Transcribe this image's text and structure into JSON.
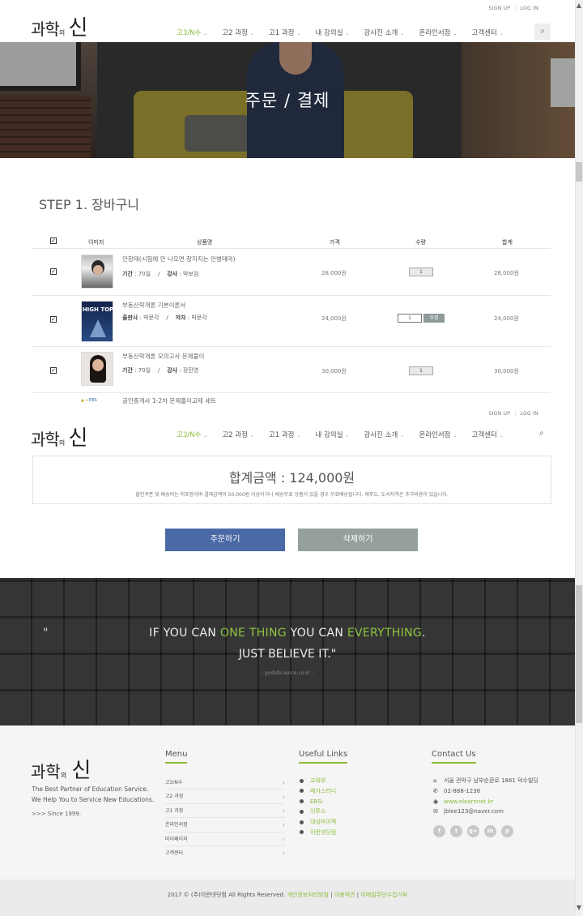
{
  "header": {
    "logo_main": "과학",
    "logo_small": "의",
    "logo_big": "신",
    "toplinks": [
      "SIGN UP",
      "LOG IN"
    ],
    "nav": [
      {
        "label": "고3/N수",
        "active": true
      },
      {
        "label": "고2 과정",
        "active": false
      },
      {
        "label": "고1 과정",
        "active": false
      },
      {
        "label": "내 강의실",
        "active": false
      },
      {
        "label": "강사진 소개",
        "active": false
      },
      {
        "label": "온라인서점",
        "active": false
      },
      {
        "label": "고객센터",
        "active": false
      }
    ]
  },
  "hero": {
    "title": "주문 / 결제"
  },
  "cart": {
    "step_title": "STEP 1. 장바구니",
    "columns": [
      "이미지",
      "상품명",
      "가격",
      "수량",
      "합계"
    ],
    "rows": [
      {
        "name": "안창태(시험에 안 나오면 장지지는 만병테마)",
        "info_a_label": "기간",
        "info_a": "70일",
        "info_b_label": "강사",
        "info_b": "박보검",
        "price": "28,000원",
        "qty": "1",
        "total": "28,000원",
        "editable": false
      },
      {
        "name": "부동산학개론 기본이론서",
        "info_a_label": "출판사",
        "info_a": "박문각",
        "info_b_label": "저자",
        "info_b": "박문각",
        "price": "24,000원",
        "qty": "1",
        "total": "24,000원",
        "editable": true,
        "edit_label": "수정",
        "cover_text": "HIGH TOP"
      },
      {
        "name": "부동산학개론 모의고사 문제풀이",
        "info_a_label": "기간",
        "info_a": "70일",
        "info_b_label": "강사",
        "info_b": "장진영",
        "price": "30,000원",
        "qty": "1",
        "total": "30,000원",
        "editable": false
      },
      {
        "name": "공인중개사 1-2차 문제풀이교재 세트"
      }
    ]
  },
  "summary": {
    "total_label": "합계금액 : 124,000원",
    "note": "할인쿠폰 및 배송비는 미포함이며 결제금액이 50,000원 이상이거나 배송무료 상품이 있을 경우 무료배송됩니다. 제주도, 도서지역은 추가비용이 있습니다.",
    "order_button": "주문하기",
    "delete_button": "삭제하기"
  },
  "quote": {
    "open_mark": "\"",
    "line1_a": "IF YOU CAN ",
    "line1_b": "ONE THING",
    "line1_c": " YOU CAN ",
    "line1_d": "EVERYTHING",
    "line1_e": ".",
    "line2": "JUST BELIEVE IT.\"",
    "source": "- godofscience.co.kr -"
  },
  "footer": {
    "desc1": "The Best Partner of Education Service.",
    "desc2": "We Help You to Service New Educations.",
    "since": ">>> Since 1999.",
    "menu_title": "Menu",
    "menu": [
      "고3/N수",
      "고2 과정",
      "고1 과정",
      "온라인서점",
      "마이페이지",
      "고객센터"
    ],
    "links_title": "Useful Links",
    "links": [
      "교육부",
      "메가스터디",
      "EBSi",
      "이투스",
      "대성마이맥",
      "이런넷닷컴"
    ],
    "contact_title": "Contact Us",
    "contact": [
      {
        "icon": "home-icon",
        "text": "서울 관악구 남부순환로 1861 덕수빌딩"
      },
      {
        "icon": "phone-icon",
        "text": "02-888-1238"
      },
      {
        "icon": "globe-icon",
        "text": "www.elearnnet.kr"
      },
      {
        "icon": "mail-icon",
        "text": "jblee123@naver.com"
      }
    ],
    "socials": [
      "f",
      "t",
      "g+",
      "in",
      "p"
    ]
  },
  "copyright": {
    "text": "2017 © (주)이런넷닷컴 All Rights Reserved.",
    "links": [
      "개인정보처리방침",
      "이용약관",
      "이메일무단수집거부"
    ]
  },
  "colors": {
    "accent": "#8dbb3a",
    "order": "#4a6aa5",
    "delete": "#95a09e"
  }
}
